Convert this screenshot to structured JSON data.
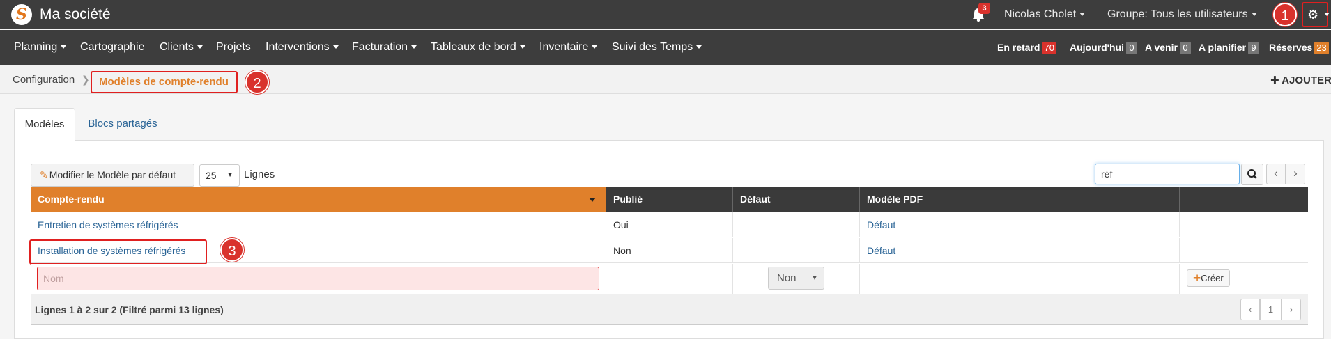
{
  "header": {
    "logo_letter": "S",
    "app_title": "Ma société",
    "notifications_count": "3",
    "user_name": "Nicolas Cholet",
    "group_label": "Groupe: Tous les utilisateurs",
    "settings_icon": "gear-icon"
  },
  "markers": [
    "1",
    "2",
    "3"
  ],
  "nav": {
    "items": [
      "Planning",
      "Cartographie",
      "Clients",
      "Projets",
      "Interventions",
      "Facturation",
      "Tableaux de bord",
      "Inventaire",
      "Suivi des Temps"
    ],
    "counters": [
      {
        "label": "En retard",
        "value": "70",
        "color": "#d9322c"
      },
      {
        "label": "Aujourd'hui",
        "value": "0",
        "color": "#777777"
      },
      {
        "label": "A venir",
        "value": "0",
        "color": "#777777"
      },
      {
        "label": "A planifier",
        "value": "9",
        "color": "#777777"
      },
      {
        "label": "Réserves",
        "value": "23",
        "color": "#e0802b"
      }
    ]
  },
  "breadcrumb": {
    "parent": "Configuration",
    "current": "Modèles de compte-rendu",
    "add_label": "AJOUTER"
  },
  "tabs": [
    "Modèles",
    "Blocs partagés"
  ],
  "toolbar": {
    "default_model_button": "Modifier le Modèle par défaut",
    "rows_value": "25",
    "rows_label": "Lignes",
    "search_value": "réf"
  },
  "table": {
    "columns": [
      "Compte-rendu",
      "Publié",
      "Défaut",
      "Modèle PDF",
      ""
    ],
    "rows": [
      {
        "name": "Entretien de systèmes réfrigérés",
        "published": "Oui",
        "default": "",
        "pdf": "Défaut"
      },
      {
        "name": "Installation de systèmes réfrigérés",
        "published": "Non",
        "default": "",
        "pdf": "Défaut"
      }
    ],
    "new_row": {
      "name_placeholder": "Nom",
      "default_value": "Non",
      "create_label": "Créer"
    },
    "footer": "Lignes 1 à 2 sur 2 (Filtré parmi 13 lignes)",
    "page": "1"
  },
  "colors": {
    "accent": "#e0802b",
    "topbar": "#3d3d3d",
    "highlight": "#e02020"
  }
}
